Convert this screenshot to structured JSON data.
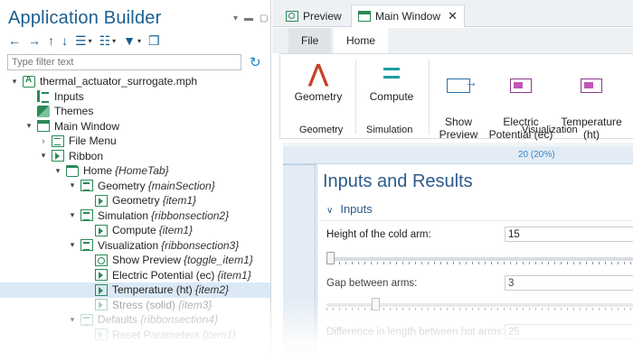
{
  "builder": {
    "title": "Application Builder",
    "filter_placeholder": "Type filter text",
    "tree": [
      {
        "label": "thermal_actuator_surrogate.mph",
        "tag": "",
        "icon": "mph-file-icon",
        "level": 0,
        "toggle": "▾"
      },
      {
        "label": "Inputs",
        "tag": "",
        "icon": "declarations-icon",
        "level": 1,
        "toggle": ""
      },
      {
        "label": "Themes",
        "tag": "",
        "icon": "themes-icon",
        "level": 1,
        "toggle": ""
      },
      {
        "label": "Main Window",
        "tag": "",
        "icon": "window-icon",
        "level": 1,
        "toggle": "▾"
      },
      {
        "label": "File Menu",
        "tag": "",
        "icon": "menu-icon",
        "level": 2,
        "toggle": "›"
      },
      {
        "label": "Ribbon",
        "tag": "",
        "icon": "ribbon-icon",
        "level": 2,
        "toggle": "▾"
      },
      {
        "label": "Home",
        "tag": "{HomeTab}",
        "icon": "folder-icon",
        "level": 3,
        "toggle": "▾"
      },
      {
        "label": "Geometry",
        "tag": "{mainSection}",
        "icon": "section-icon",
        "level": 4,
        "toggle": "▾"
      },
      {
        "label": "Geometry",
        "tag": "{item1}",
        "icon": "item-icon",
        "level": 5,
        "toggle": ""
      },
      {
        "label": "Simulation",
        "tag": "{ribbonsection2}",
        "icon": "section-icon",
        "level": 4,
        "toggle": "▾"
      },
      {
        "label": "Compute",
        "tag": "{item1}",
        "icon": "item-icon",
        "level": 5,
        "toggle": ""
      },
      {
        "label": "Visualization",
        "tag": "{ribbonsection3}",
        "icon": "section-icon",
        "level": 4,
        "toggle": "▾"
      },
      {
        "label": "Show Preview",
        "tag": "{toggle_item1}",
        "icon": "toggle-icon",
        "level": 5,
        "toggle": ""
      },
      {
        "label": "Electric Potential (ec)",
        "tag": "{item1}",
        "icon": "item-icon",
        "level": 5,
        "toggle": ""
      },
      {
        "label": "Temperature (ht)",
        "tag": "{item2}",
        "icon": "item-icon",
        "level": 5,
        "toggle": "",
        "selected": true
      },
      {
        "label": "Stress (solid)",
        "tag": "{item3}",
        "icon": "item-icon",
        "level": 5,
        "toggle": "",
        "dim": true
      },
      {
        "label": "Defaults",
        "tag": "{ribbonsection4}",
        "icon": "section-icon",
        "level": 4,
        "toggle": "▾",
        "dim": true
      },
      {
        "label": "Reset Parameters",
        "tag": "{item1}",
        "icon": "item-icon",
        "level": 5,
        "toggle": "",
        "dim": true
      }
    ]
  },
  "tabs": {
    "preview": "Preview",
    "main_window": "Main Window"
  },
  "ribbon": {
    "file_tab": "File",
    "home_tab": "Home",
    "buttons": {
      "geometry": "Geometry",
      "compute": "Compute",
      "show_preview": "Show\nPreview",
      "electric_potential": "Electric\nPotential (ec)",
      "temperature": "Temperature\n(ht)"
    },
    "groups": {
      "geometry": "Geometry",
      "simulation": "Simulation",
      "visualization": "Visualization"
    }
  },
  "form": {
    "ruler_label": "20 (20%)",
    "title": "Inputs and Results",
    "section": "Inputs",
    "fields": [
      {
        "label": "Height of the cold arm:",
        "value": "15"
      },
      {
        "label": "Gap between arms:",
        "value": "3"
      },
      {
        "label": "Difference in length between hot arms:",
        "value": "25"
      }
    ]
  }
}
